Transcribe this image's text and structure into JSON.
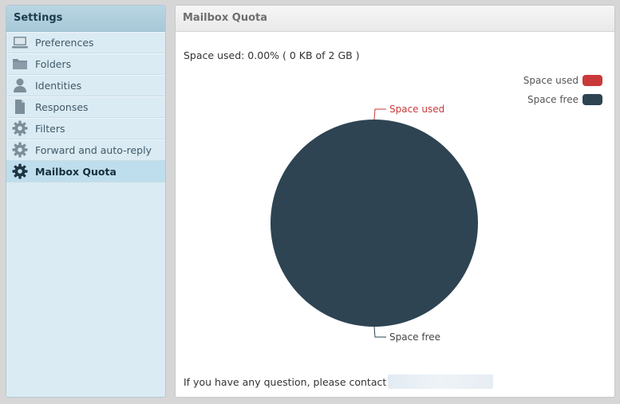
{
  "sidebar": {
    "title": "Settings",
    "items": [
      {
        "label": "Preferences",
        "icon": "monitor-icon",
        "selected": false
      },
      {
        "label": "Folders",
        "icon": "folder-icon",
        "selected": false
      },
      {
        "label": "Identities",
        "icon": "person-icon",
        "selected": false
      },
      {
        "label": "Responses",
        "icon": "document-icon",
        "selected": false
      },
      {
        "label": "Filters",
        "icon": "gear-icon",
        "selected": false
      },
      {
        "label": "Forward and auto-reply",
        "icon": "gear-icon",
        "selected": false
      },
      {
        "label": "Mailbox Quota",
        "icon": "gear-icon",
        "selected": true
      }
    ]
  },
  "main": {
    "title": "Mailbox Quota",
    "space_used_text": "Space used: 0.00% ( 0 KB of 2 GB )",
    "footer_text": "If you have any question, please contact"
  },
  "colors": {
    "space_used": "#c9393a",
    "space_free": "#2e4453",
    "sidebar_bg": "#dbebf3",
    "sidebar_selected": "#bedeed"
  },
  "chart_data": {
    "type": "pie",
    "categories": [
      "Space used",
      "Space free"
    ],
    "values": [
      0.0,
      100.0
    ],
    "legend_position": "top-right",
    "slice_labels": [
      "Space used",
      "Space free"
    ]
  }
}
